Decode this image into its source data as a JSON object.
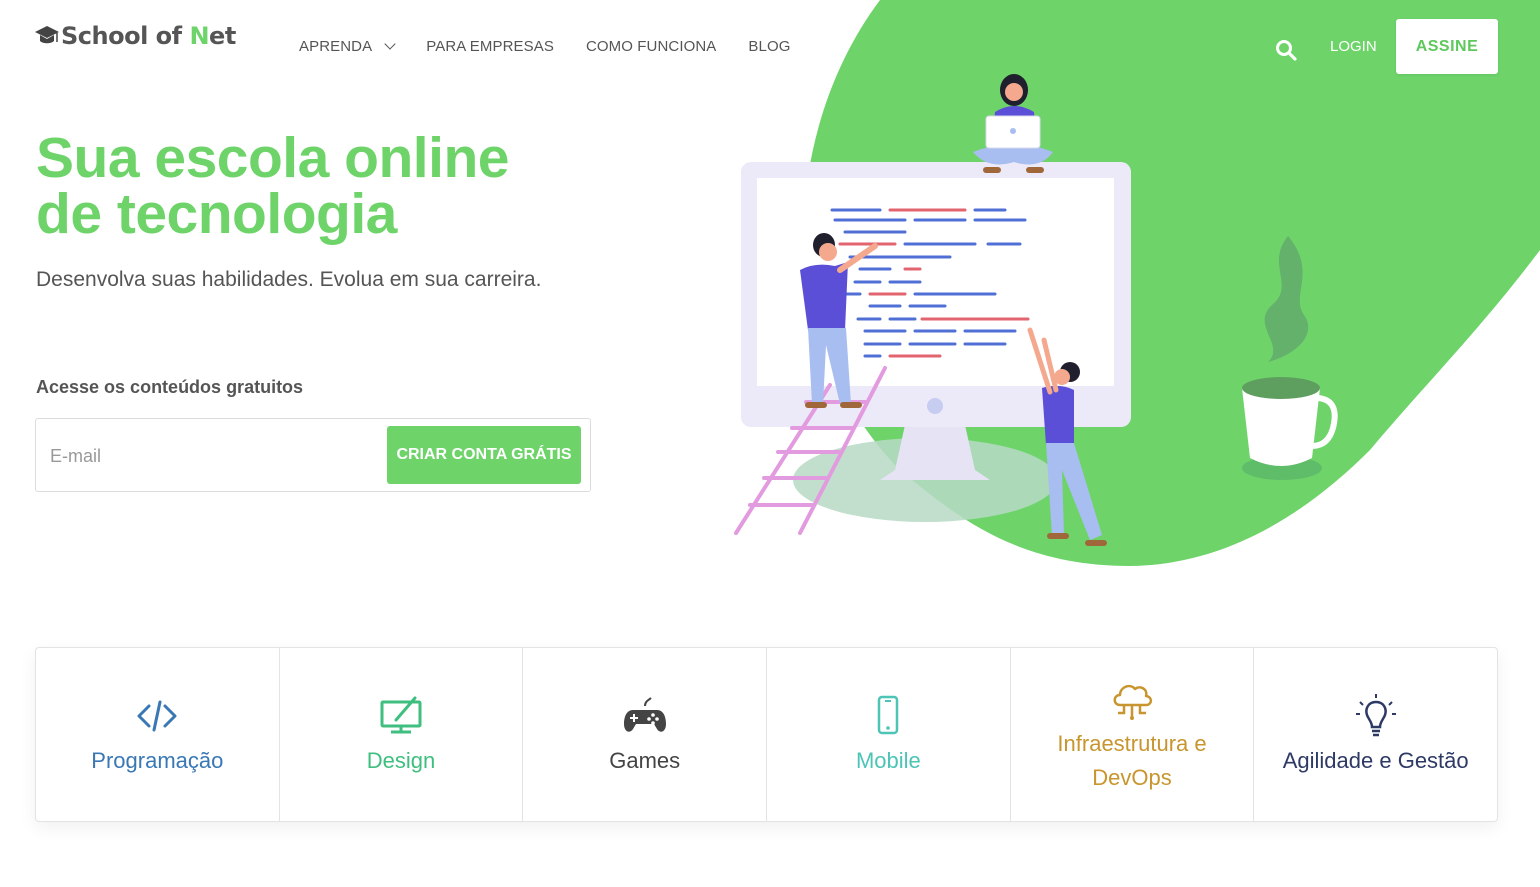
{
  "header": {
    "logo_text_pre": "School of ",
    "logo_text_accent": "N",
    "logo_text_post": "et",
    "nav": [
      {
        "label": "APRENDA",
        "has_dropdown": true
      },
      {
        "label": "PARA EMPRESAS"
      },
      {
        "label": "COMO FUNCIONA"
      },
      {
        "label": "BLOG"
      }
    ],
    "login_label": "LOGIN",
    "assine_label": "ASSINE"
  },
  "hero": {
    "title_line1": "Sua escola online",
    "title_line2": "de tecnologia",
    "subtitle": "Desenvolva suas habilidades. Evolua em sua carreira.",
    "free_label": "Acesse os conteúdos gratuitos",
    "email_placeholder": "E-mail",
    "email_value": "",
    "cta_label": "CRIAR CONTA GRÁTIS"
  },
  "categories": [
    {
      "label": "Programação",
      "icon": "code-icon",
      "color": "#3a78b5"
    },
    {
      "label": "Design",
      "icon": "monitor-pen-icon",
      "color": "#3fbf7f"
    },
    {
      "label": "Games",
      "icon": "gamepad-icon",
      "color": "#444444"
    },
    {
      "label": "Mobile",
      "icon": "mobile-phone-icon",
      "color": "#4cc4b6"
    },
    {
      "label": "Infraestrutura e DevOps",
      "icon": "cloud-network-icon",
      "color": "#c8952e"
    },
    {
      "label": "Agilidade e Gestão",
      "icon": "lightbulb-icon",
      "color": "#2e3a66"
    }
  ],
  "colors": {
    "brand_green": "#6ed46a",
    "text": "#555555"
  }
}
